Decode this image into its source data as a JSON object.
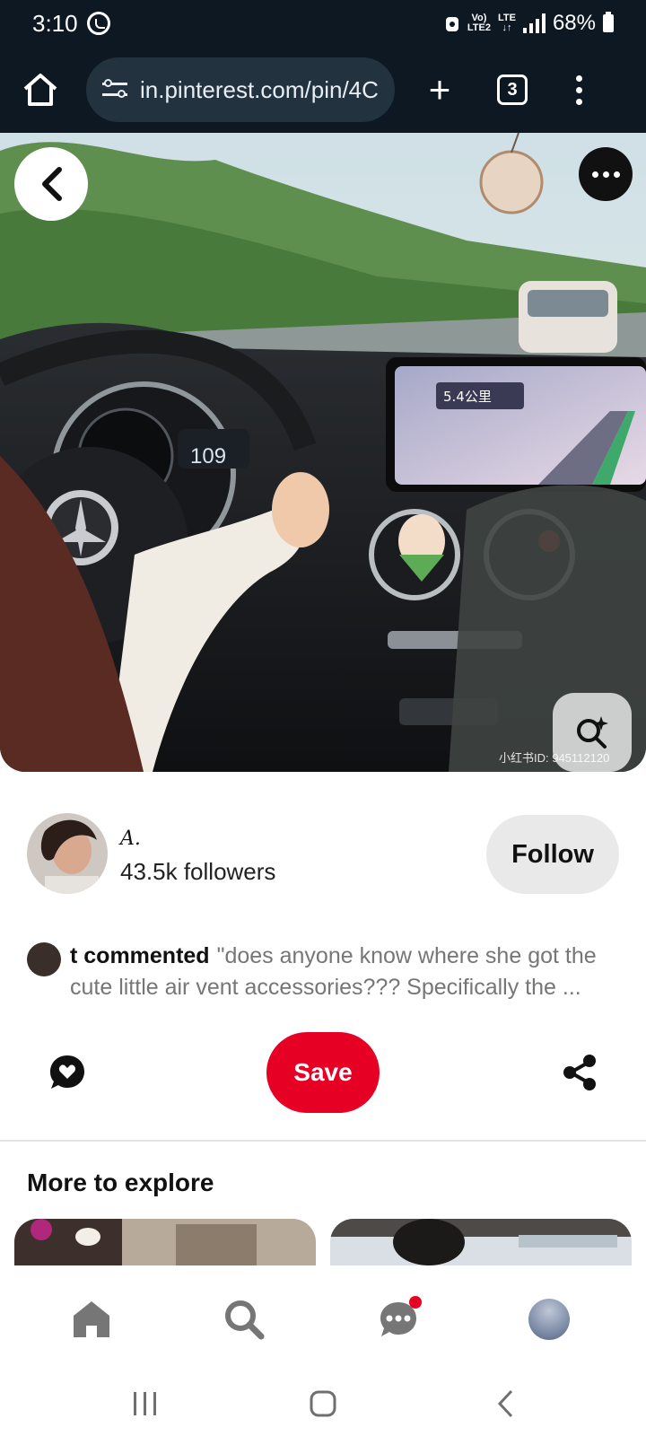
{
  "status_bar": {
    "time": "3:10",
    "network_top": "Vo)",
    "network_bottom": "LTE2",
    "lte_label": "LTE",
    "battery": "68%"
  },
  "browser": {
    "url": "in.pinterest.com/pin/4C",
    "tab_count": "3"
  },
  "pin": {
    "speed_readout": "109",
    "nav_distance": "5.4公里",
    "watermark": "小红书ID: 945112120"
  },
  "creator": {
    "name": "A.",
    "followers": "43.5k followers",
    "follow_label": "Follow"
  },
  "comment": {
    "author_action": "t commented",
    "text": "\"does anyone know where she got the cute little air vent accessories??? Specifically the ..."
  },
  "actions": {
    "save_label": "Save"
  },
  "explore": {
    "title": "More to explore"
  },
  "icons": {
    "home": "home-icon",
    "search": "search-icon",
    "messages": "chat-bubble-icon",
    "profile": "profile-avatar",
    "share": "share-icon",
    "reaction": "heart-bubble-icon"
  },
  "colors": {
    "brand_red": "#e60023",
    "chrome_dark": "#0e1822"
  }
}
